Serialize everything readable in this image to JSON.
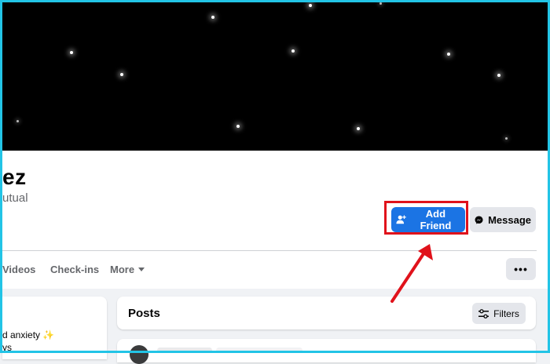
{
  "profile": {
    "name_fragment": "ez",
    "mutual_fragment": "utual"
  },
  "actions": {
    "add_friend_label": "Add Friend",
    "message_label": "Message",
    "more_dots": "•••"
  },
  "tabs": {
    "videos": "Videos",
    "checkins": "Check-ins",
    "more": "More"
  },
  "intro": {
    "line1": "d anxiety ✨",
    "line2": "ys"
  },
  "posts": {
    "title": "Posts",
    "filters_label": "Filters"
  },
  "colors": {
    "accent_blue": "#1b74e4",
    "highlight_red": "#e0121b",
    "frame_cyan": "#22c4e6"
  },
  "icons": {
    "add_friend": "person-add-icon",
    "message": "messenger-icon",
    "more": "caret-down-icon",
    "filters": "sliders-icon"
  }
}
